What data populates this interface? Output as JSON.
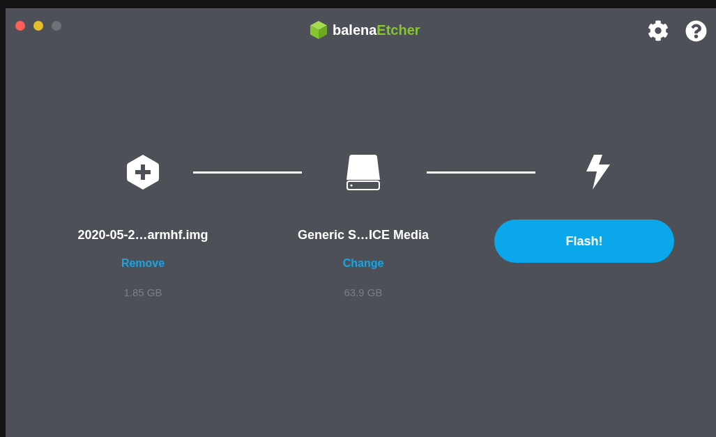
{
  "window": {
    "controls": [
      {
        "color": "#fe5f57"
      },
      {
        "color": "#e5bf29"
      },
      {
        "color": "#6e7176"
      }
    ]
  },
  "logo": {
    "brand": "balena",
    "product": "Etcher"
  },
  "toolbar": [
    {
      "kind": "settings"
    },
    {
      "kind": "help"
    }
  ],
  "steps": [
    {
      "kind": "image",
      "name": "2020-05-2…armhf.img",
      "action": "Remove",
      "size": "1.85 GB"
    },
    {
      "kind": "drive",
      "name": "Generic S…ICE Media",
      "action": "Change",
      "size": "63.9 GB"
    },
    {
      "kind": "flash",
      "button": "Flash!"
    }
  ]
}
